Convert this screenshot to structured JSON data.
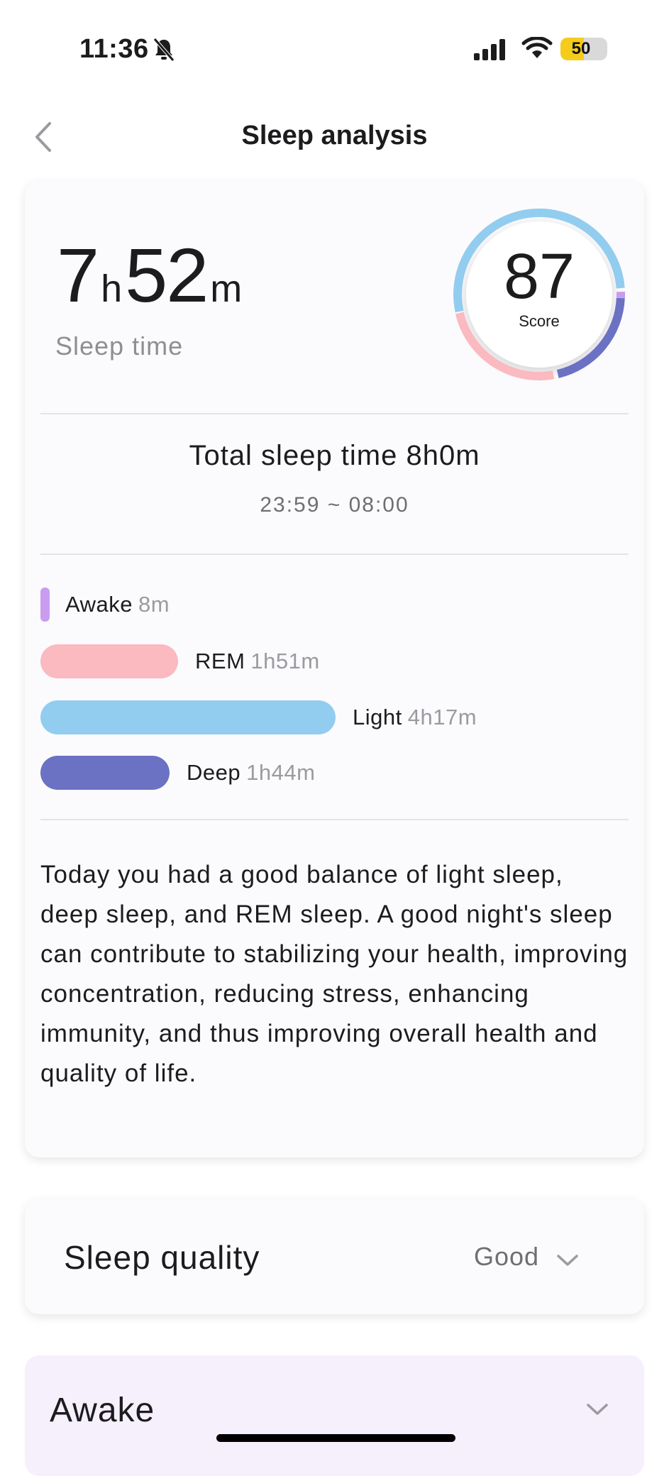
{
  "status_bar": {
    "time": "11:36",
    "battery": "50",
    "battery_level": 0.5
  },
  "nav": {
    "title": "Sleep analysis"
  },
  "summary": {
    "hours": "7",
    "hours_unit": "h",
    "minutes": "52",
    "minutes_unit": "m",
    "label": "Sleep time",
    "score": "87",
    "score_label": "Score",
    "total_sleep": "Total sleep time 8h0m",
    "range": "23:59 ~ 08:00"
  },
  "stages": [
    {
      "name": "Awake",
      "value": "8m",
      "color": "#c99cf0"
    },
    {
      "name": "REM",
      "value": "1h51m",
      "color": "#fbb9c0"
    },
    {
      "name": "Light",
      "value": "4h17m",
      "color": "#92cdef"
    },
    {
      "name": "Deep",
      "value": "1h44m",
      "color": "#6b72c4"
    }
  ],
  "description": "Today you had a good balance of light sleep, deep sleep, and REM sleep. A good night's sleep can contribute to stabilizing your health, improving concentration, reducing stress, enhancing immunity, and thus improving overall health and quality of life.",
  "quality": {
    "title": "Sleep quality",
    "value": "Good"
  },
  "awake_section": {
    "title": "Awake"
  }
}
